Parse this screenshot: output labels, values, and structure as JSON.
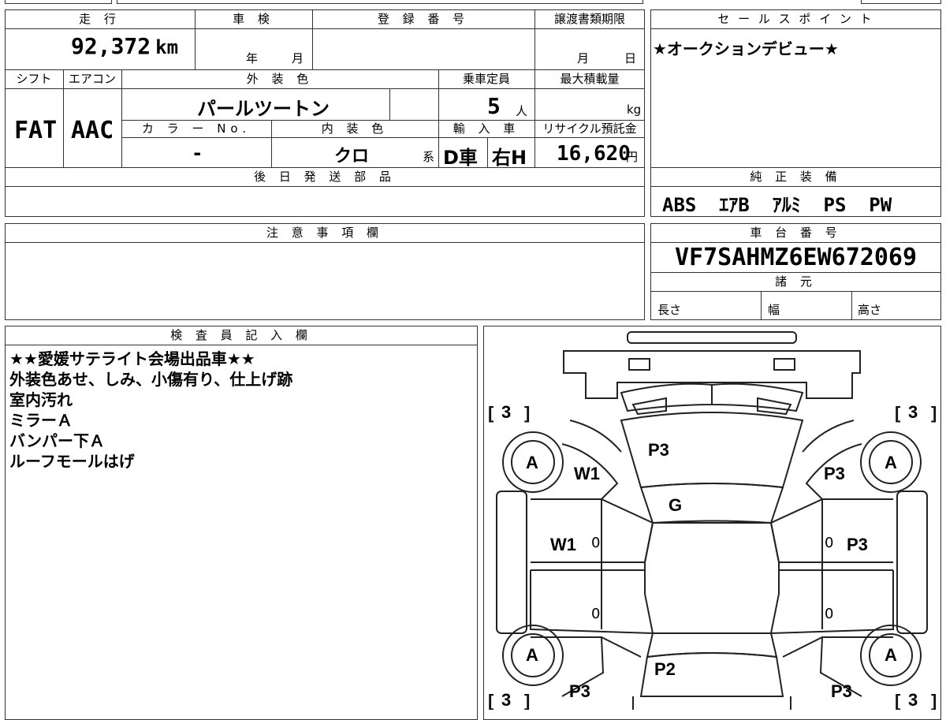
{
  "mileage": {
    "header": "走 行",
    "value": "92,372",
    "unit": "km"
  },
  "shaken": {
    "header": "車 検",
    "year": "年",
    "month": "月"
  },
  "registration": {
    "header": "登 録 番 号",
    "value": ""
  },
  "transfer": {
    "header": "譲渡書類期限",
    "month": "月",
    "day": "日"
  },
  "shift": {
    "header": "シフト",
    "value": "FAT"
  },
  "ac": {
    "header": "エアコン",
    "value": "AAC"
  },
  "exterior_color": {
    "header": "外 装 色",
    "value": "パールツートン"
  },
  "capacity": {
    "header": "乗車定員",
    "value": "5",
    "unit": "人"
  },
  "max_load": {
    "header": "最大積載量",
    "value": "",
    "unit": "kg"
  },
  "color_no": {
    "header": "カ ラ ー No.",
    "value": "-"
  },
  "interior_color": {
    "header": "内 装 色",
    "value": "クロ",
    "suffix": "系"
  },
  "import": {
    "header": "輸 入 車",
    "value": "D車",
    "handle": "右H"
  },
  "recycle": {
    "header": "リサイクル預託金",
    "value": "16,620",
    "unit": "円"
  },
  "later_parts": {
    "header": "後 日 発 送 部 品",
    "value": ""
  },
  "notes": {
    "header": "注 意 事 項 欄",
    "value": ""
  },
  "selling_points": {
    "header": "セ ー ル ス ポ イ ン ト",
    "value": "★オークションデビュー★"
  },
  "equipment": {
    "header": "純 正 装 備",
    "value": "ABS  ｴｱB  ｱﾙﾐ  PS  PW"
  },
  "chassis": {
    "header": "車 台 番 号",
    "value": "VF7SAHMZ6EW672069"
  },
  "specs": {
    "header": "諸 元",
    "length": "長さ",
    "width": "幅",
    "height": "高さ"
  },
  "inspector": {
    "header": "検 査 員 記 入 欄",
    "lines": [
      "★★愛媛サテライト会場出品車★★",
      "外装色あせ、しみ、小傷有り、仕上げ跡",
      "室内汚れ",
      "ミラーＡ",
      "バンパー下Ａ",
      "ルーフモールはげ"
    ]
  },
  "diagram": {
    "tires": {
      "fl": "A",
      "fr": "A",
      "rl": "A",
      "rr": "A"
    },
    "tread": {
      "fl": "3",
      "fr": "3",
      "rl": "3",
      "rr": "3"
    },
    "marks": {
      "hood": "P3",
      "windshield": "G",
      "front_left_fender": "W1",
      "front_right_fender": "P3",
      "front_left_door": "W1",
      "front_right_door": "P3",
      "trunk": "P2",
      "rear_left": "P3",
      "rear_right": "P3"
    },
    "zeros": [
      "0",
      "0",
      "0",
      "0"
    ]
  }
}
